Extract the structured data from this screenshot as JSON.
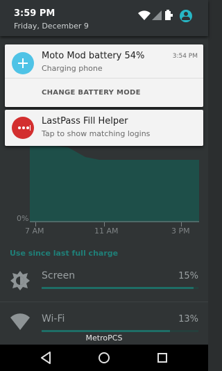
{
  "status": {
    "time": "3:59 PM",
    "date": "Friday, December 9"
  },
  "notifications": [
    {
      "title": "Moto Mod battery 54%",
      "text": "Charging phone",
      "time": "3:54 PM",
      "action": "CHANGE BATTERY MODE",
      "icon": "plus-icon",
      "icon_color": "#4fc3e6"
    },
    {
      "title": "LastPass Fill Helper",
      "text": "Tap to show matching logins",
      "icon": "dots-icon",
      "icon_color": "#d32f2f"
    }
  ],
  "battery_app": {
    "chart": {
      "y_axis_label": "0%",
      "x_ticks": [
        "7 AM",
        "11 AM",
        "3 PM"
      ],
      "fill_color": "#1e5b54"
    },
    "section_title": "Use since last full charge",
    "usage": [
      {
        "label": "Screen",
        "percent": "15%",
        "level": 0.97,
        "icon": "brightness-icon"
      },
      {
        "label": "Wi-Fi",
        "percent": "13%",
        "level": 0.82,
        "icon": "wifi-icon"
      }
    ]
  },
  "carrier": "MetroPCS",
  "accent": "#27b7c5"
}
